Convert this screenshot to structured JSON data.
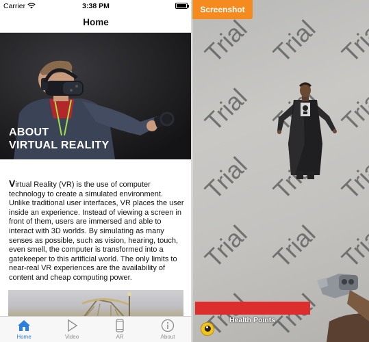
{
  "status_bar": {
    "carrier": "Carrier",
    "time": "3:38 PM",
    "battery_level": 0.9
  },
  "nav": {
    "title": "Home"
  },
  "hero": {
    "title_line1": "ABOUT",
    "title_line2": "VIRTUAL REALITY"
  },
  "article": {
    "drop_cap": "V",
    "body": "irtual Reality (VR) is the use of computer technology to create a simulated environment. Unlike traditional user interfaces, VR places the user inside an experience. Instead of viewing a screen in front of them, users are immersed and able to interact with 3D worlds. By simulating as many senses as possible, such as vision, hearing, touch, even smell, the computer is transformed into a gatekeeper to this artificial world. The only limits to near-real VR experiences are the availability of content and cheap computing power."
  },
  "tabs": [
    {
      "label": "Home",
      "icon": "home-icon",
      "active": true
    },
    {
      "label": "Video",
      "icon": "play-icon",
      "active": false
    },
    {
      "label": "AR",
      "icon": "phone-icon",
      "active": false
    },
    {
      "label": "About",
      "icon": "info-icon",
      "active": false
    }
  ],
  "ar": {
    "screenshot_label": "Screenshot",
    "watermark_text": "Trial",
    "health_label": "Health Points",
    "accent_orange": "#f58a1f",
    "health_color": "#dc2f2d"
  }
}
